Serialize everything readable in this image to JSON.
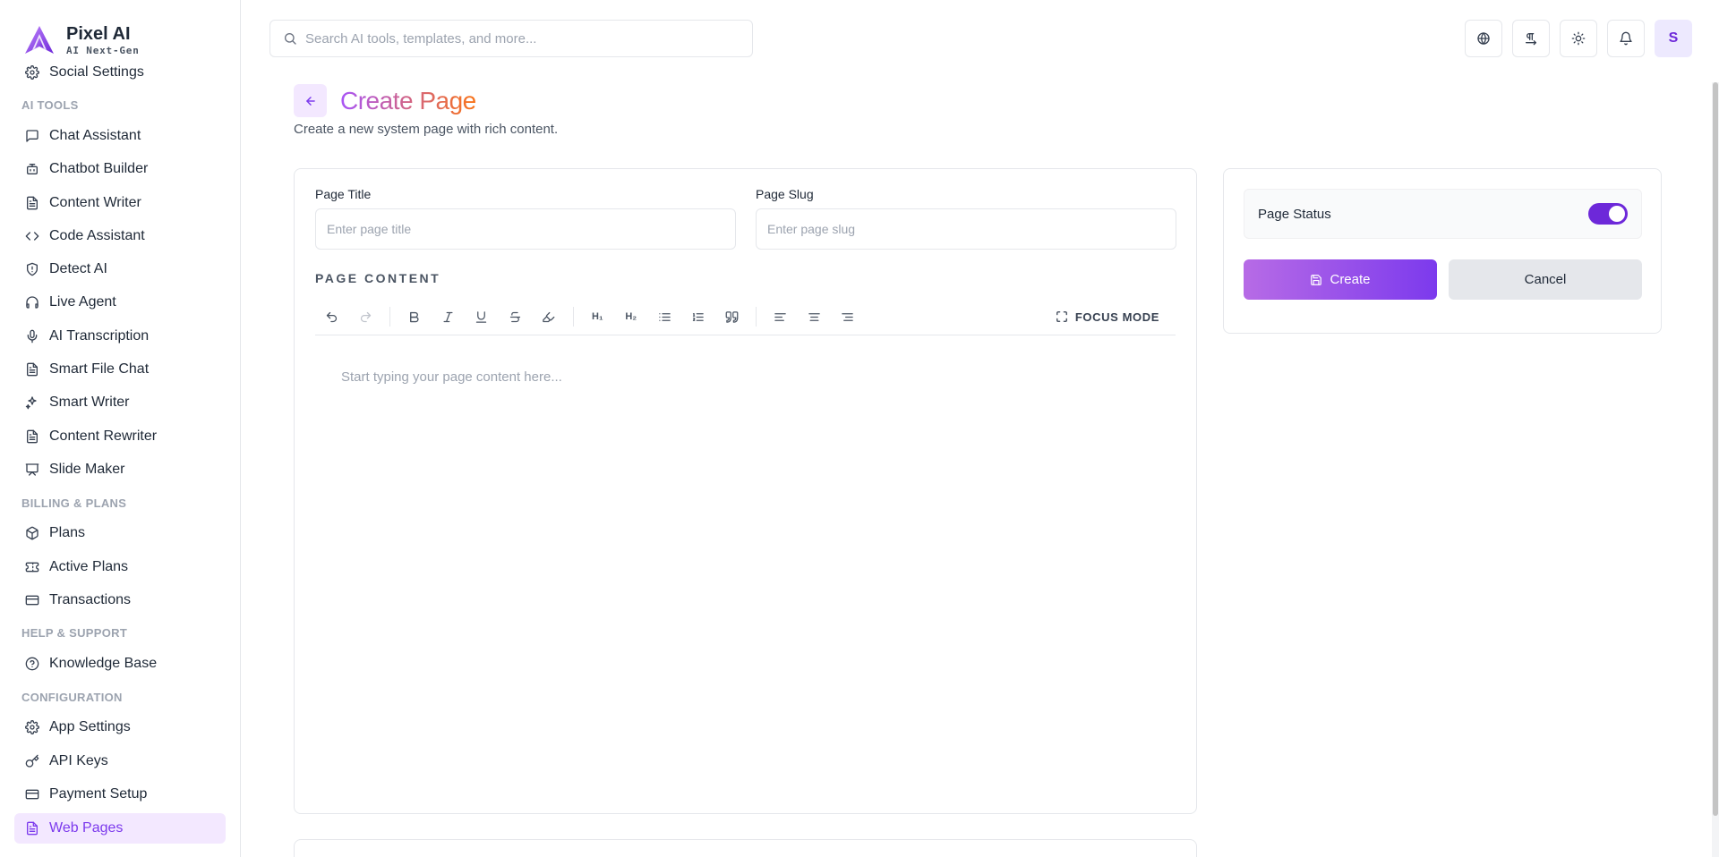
{
  "brand": {
    "name": "Pixel AI",
    "tagline": "AI Next-Gen"
  },
  "sidebar": {
    "items": [
      {
        "type": "item",
        "label": "Social Settings",
        "icon": "gear-icon"
      },
      {
        "type": "section",
        "label": "AI TOOLS"
      },
      {
        "type": "item",
        "label": "Chat Assistant",
        "icon": "message-square-icon"
      },
      {
        "type": "item",
        "label": "Chatbot Builder",
        "icon": "bot-icon"
      },
      {
        "type": "item",
        "label": "Content Writer",
        "icon": "file-text-icon"
      },
      {
        "type": "item",
        "label": "Code Assistant",
        "icon": "code-icon"
      },
      {
        "type": "item",
        "label": "Detect AI",
        "icon": "shield-icon"
      },
      {
        "type": "item",
        "label": "Live Agent",
        "icon": "headphones-icon"
      },
      {
        "type": "item",
        "label": "AI Transcription",
        "icon": "mic-icon"
      },
      {
        "type": "item",
        "label": "Smart File Chat",
        "icon": "file-text-icon"
      },
      {
        "type": "item",
        "label": "Smart Writer",
        "icon": "sparkles-icon"
      },
      {
        "type": "item",
        "label": "Content Rewriter",
        "icon": "file-text-icon"
      },
      {
        "type": "item",
        "label": "Slide Maker",
        "icon": "presentation-icon"
      },
      {
        "type": "section",
        "label": "BILLING & PLANS"
      },
      {
        "type": "item",
        "label": "Plans",
        "icon": "package-icon"
      },
      {
        "type": "item",
        "label": "Active Plans",
        "icon": "ticket-icon"
      },
      {
        "type": "item",
        "label": "Transactions",
        "icon": "credit-card-icon"
      },
      {
        "type": "section",
        "label": "HELP & SUPPORT"
      },
      {
        "type": "item",
        "label": "Knowledge Base",
        "icon": "help-circle-icon"
      },
      {
        "type": "section",
        "label": "CONFIGURATION"
      },
      {
        "type": "item",
        "label": "App Settings",
        "icon": "gear-icon"
      },
      {
        "type": "item",
        "label": "API Keys",
        "icon": "key-icon"
      },
      {
        "type": "item",
        "label": "Payment Setup",
        "icon": "credit-card-icon"
      },
      {
        "type": "item",
        "label": "Web Pages",
        "icon": "file-text-icon",
        "active": true
      }
    ]
  },
  "header": {
    "search_placeholder": "Search AI tools, templates, and more...",
    "avatar_initial": "S",
    "icons": [
      "globe-icon",
      "translate-icon",
      "sun-icon",
      "bell-icon"
    ]
  },
  "page": {
    "title": "Create Page",
    "description": "Create a new system page with rich content."
  },
  "form": {
    "title_label": "Page Title",
    "title_placeholder": "Enter page title",
    "title_value": "",
    "slug_label": "Page Slug",
    "slug_placeholder": "Enter page slug",
    "slug_value": "",
    "content_label": "PAGE CONTENT",
    "editor_placeholder": "Start typing your page content here...",
    "focus_mode_label": "FOCUS MODE",
    "toolbar": {
      "h1": "H₁",
      "h2": "H₂"
    }
  },
  "status_panel": {
    "status_label": "Page Status",
    "status_enabled": true,
    "create_label": "Create",
    "cancel_label": "Cancel"
  },
  "colors": {
    "accent": "#7c3aed",
    "accent_light": "#f3e8ff",
    "title_gradient_start": "#a855f7",
    "title_gradient_end": "#f97316"
  }
}
